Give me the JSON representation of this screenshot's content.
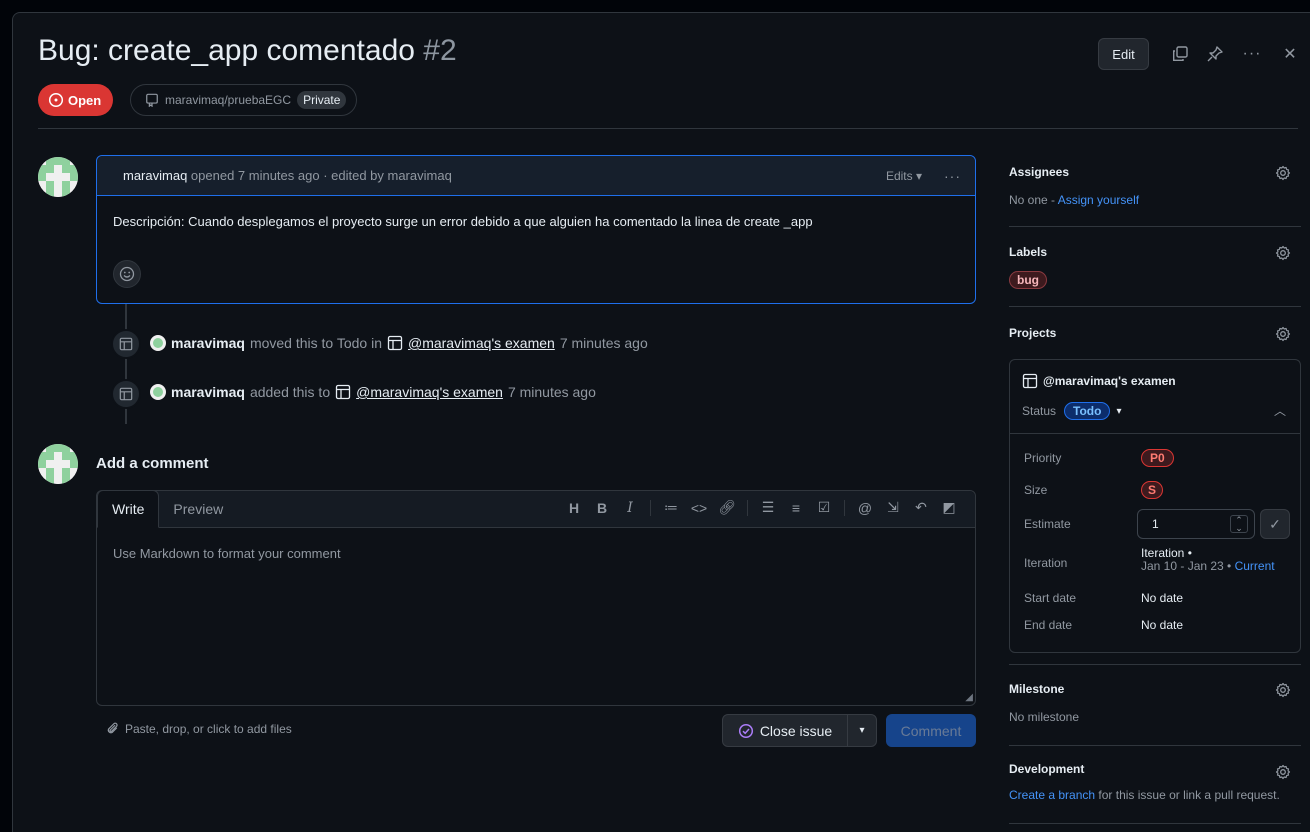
{
  "header": {
    "title": "Bug: create_app comentado",
    "number": "#2",
    "status": "Open",
    "repo": "maravimaq/pruebaEGC",
    "visibility": "Private",
    "edit_label": "Edit"
  },
  "comment": {
    "author": "maravimaq",
    "meta": "opened 7 minutes ago · edited by maravimaq",
    "edits_label": "Edits",
    "body": "Descripción: Cuando desplegamos el proyecto surge un error debido a que alguien ha comentado la linea de create _app"
  },
  "events": [
    {
      "actor": "maravimaq",
      "action": "moved this to Todo in",
      "project": "@maravimaq's examen",
      "time": "7 minutes ago"
    },
    {
      "actor": "maravimaq",
      "action": "added this to",
      "project": "@maravimaq's examen",
      "time": "7 minutes ago"
    }
  ],
  "new_comment": {
    "heading": "Add a comment",
    "tab_write": "Write",
    "tab_preview": "Preview",
    "placeholder": "Use Markdown to format your comment",
    "attach_hint": "Paste, drop, or click to add files",
    "close_issue_label": "Close issue",
    "comment_label": "Comment"
  },
  "sidebar": {
    "assignees": {
      "title": "Assignees",
      "text": "No one - ",
      "link": "Assign yourself"
    },
    "labels": {
      "title": "Labels",
      "items": [
        "bug"
      ]
    },
    "projects": {
      "title": "Projects",
      "project_name": "@maravimaq's examen",
      "status_label": "Status",
      "status_value": "Todo",
      "fields": {
        "priority_label": "Priority",
        "priority_value": "P0",
        "size_label": "Size",
        "size_value": "S",
        "estimate_label": "Estimate",
        "estimate_value": "1",
        "iteration_label": "Iteration",
        "iteration_value": "Iteration •",
        "iteration_range": "Jan 10 - Jan 23 • ",
        "iteration_current": "Current",
        "start_label": "Start date",
        "start_value": "No date",
        "end_label": "End date",
        "end_value": "No date"
      }
    },
    "milestone": {
      "title": "Milestone",
      "text": "No milestone"
    },
    "development": {
      "title": "Development",
      "link": "Create a branch",
      "text": " for this issue or link a pull request."
    }
  },
  "colors": {
    "open_red": "#da3633",
    "accent_blue": "#1f6feb",
    "link_blue": "#4493f8",
    "comment_green_disabled": "#58a6ff"
  }
}
